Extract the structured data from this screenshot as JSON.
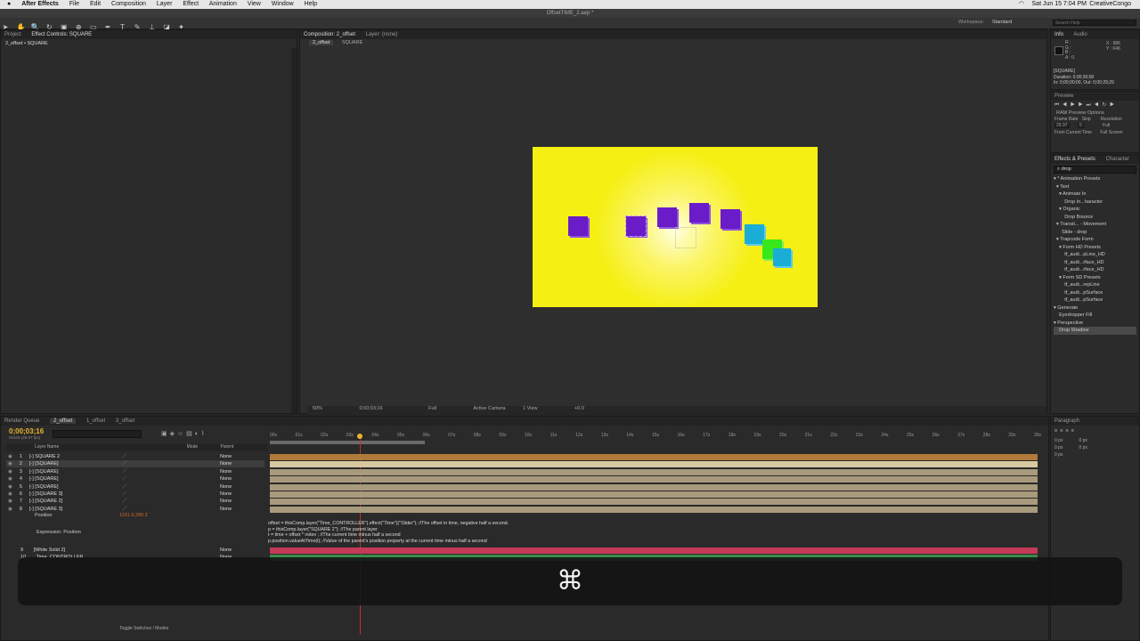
{
  "menu": {
    "app": "After Effects",
    "items": [
      "File",
      "Edit",
      "Composition",
      "Layer",
      "Effect",
      "Animation",
      "View",
      "Window",
      "Help"
    ],
    "status_datetime": "Sat Jun 15  7:04 PM",
    "status_user": "CreativeCongo"
  },
  "window": {
    "title": "OffsetTIME_2.aep *"
  },
  "toolbar": {
    "workspace_label": "Workspace:",
    "workspace_value": "Standard",
    "search_placeholder": "Search Help"
  },
  "left_panel": {
    "tabs": [
      "Project",
      "Effect Controls: SQUARE"
    ],
    "subtitle": "2_offset • SQUARE"
  },
  "comp": {
    "tabs": [
      "Composition: 2_offset",
      "Layer: (none)"
    ],
    "breadcrumbs": [
      "2_offset",
      "SQUARE"
    ],
    "bg_color": "#f5ef14",
    "square_color": "#6a1cc9",
    "cyan_color": "#1aaed6",
    "green_color": "#38e81a",
    "footer": {
      "zoom": "50%",
      "timecode": "0;00;03;16",
      "resolution": "Full",
      "camera": "Active Camera",
      "view": "1 View",
      "exposure": "+0.0"
    }
  },
  "info": {
    "tabs": [
      "Info",
      "Audio"
    ],
    "color_labels": [
      "R :",
      "G :",
      "B :",
      "A : 0"
    ],
    "coords": "X : 986\nY : 646",
    "layer": "[SQUARE]",
    "duration": "Duration: 0;00;30;00",
    "inout": "In: 0;00;00;00, Out: 0;00;29;29"
  },
  "preview": {
    "title": "Preview",
    "ram": "RAM Preview Options",
    "labels": [
      "Frame Rate",
      "Skip",
      "Resolution"
    ],
    "values": [
      "29.97",
      "0",
      "Full"
    ],
    "from_current": "From Current Time",
    "full_screen": "Full Screen"
  },
  "effects": {
    "tabs": [
      "Effects & Presets",
      "Character"
    ],
    "search": "drop",
    "tree": [
      "▾ * Animation Presets",
      "  ▾ Text",
      "    ▾ Animate In",
      "        Drop In...haracter",
      "    ▾ Organic",
      "        Drop Bounce",
      "  ▾ Transit... - Movement",
      "      Slide - drop",
      "  ▾ Trapcode Form",
      "    ▾ Form HD Presets",
      "        tf_audi...pLine_HD",
      "        tf_audi...rface_HD",
      "        tf_audi...rface_HD",
      "    ▾ Form SD Presets",
      "        tf_audi...repLine",
      "        tf_audi...pSurface",
      "        tf_audi...pSurface",
      "▾ Generate",
      "    Eyedropper Fill",
      "▾ Perspective",
      "    Drop Shadow"
    ]
  },
  "timeline": {
    "tabs": [
      "Render Queue",
      "2_offset",
      "1_offset",
      "3_offset"
    ],
    "timecode": "0;00;03;16",
    "fps": "00106 (29.97 fps)",
    "header": "Layer Name",
    "mode": "Mode",
    "parent": "Parent",
    "layers": [
      {
        "num": "1",
        "name": "[-] SQUARE 2",
        "parent": "None"
      },
      {
        "num": "2",
        "name": "[-] [SQUARE]",
        "parent": "None"
      },
      {
        "num": "3",
        "name": "[-] [SQUARE]",
        "parent": "None"
      },
      {
        "num": "4",
        "name": "[-] [SQUARE]",
        "parent": "None"
      },
      {
        "num": "5",
        "name": "[-] [SQUARE]",
        "parent": "None"
      },
      {
        "num": "6",
        "name": "[-] [SQUARE 3]",
        "parent": "None"
      },
      {
        "num": "7",
        "name": "[-] [SQUARE 2]",
        "parent": "None"
      },
      {
        "num": "8",
        "name": "[-] [SQUARE 3]",
        "parent": "None"
      }
    ],
    "position_label": "Position",
    "position_value": "1161.9,290.2",
    "expression_label": "Expression: Position",
    "expression": [
      "offset = thisComp.layer(\"Time_CONTROLLER\").effect(\"Time\")(\"Slider\"); //The offset in time, negative half a second.",
      "p = thisComp.layer(\"SQUARE 2\"); //The parent layer",
      "t = time + offset * index ; //The current time minus half a second",
      "p.position.valueAtTime(t); //Value of the parent's position property at the current time minus half a second"
    ],
    "extra_layers": [
      {
        "num": "9",
        "name": "[White Solid 2]",
        "parent": "None"
      },
      {
        "num": "10",
        "name": "Time_CONTROLLER",
        "parent": "None"
      }
    ],
    "ruler": [
      "00s",
      "01s",
      "02s",
      "03s",
      "04s",
      "05s",
      "06s",
      "07s",
      "08s",
      "09s",
      "10s",
      "11s",
      "12s",
      "13s",
      "14s",
      "15s",
      "16s",
      "17s",
      "18s",
      "19s",
      "20s",
      "21s",
      "22s",
      "23s",
      "24s",
      "25s",
      "26s",
      "27s",
      "28s",
      "29s",
      "30s"
    ],
    "toggle": "Toggle Switches / Modes"
  },
  "paragraph": {
    "title": "Paragraph",
    "px": [
      "0 px",
      "0 px",
      "0 px",
      "0 px",
      "0 px"
    ]
  },
  "overlay": {
    "glyph": "⌘"
  }
}
